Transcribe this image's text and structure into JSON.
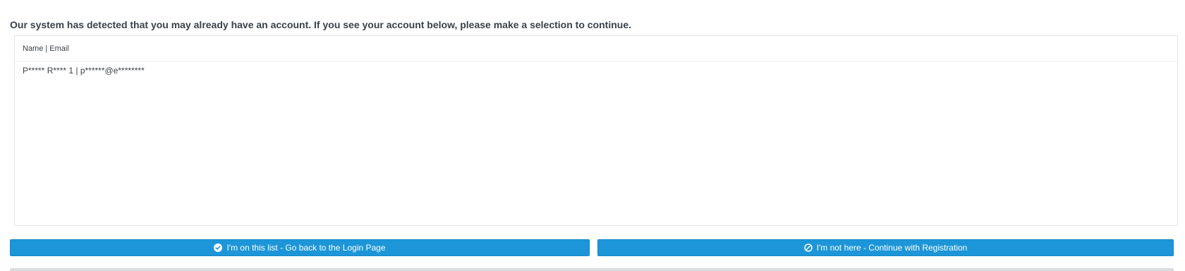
{
  "notice": "Our system has detected that you may already have an account. If you see your account below, please make a selection to continue.",
  "accounts_list": {
    "header": "Name | Email",
    "rows": [
      {
        "label": "P***** R**** 1 | p******@e********"
      }
    ]
  },
  "buttons": {
    "login": {
      "label": "I'm on this list - Go back to the Login Page",
      "icon": "check-circle-icon"
    },
    "register": {
      "label": "I'm not here - Continue with Registration",
      "icon": "ban-icon"
    }
  },
  "colors": {
    "primary": "#1c96d8",
    "text": "#39414a",
    "border": "#e3e6e9"
  }
}
